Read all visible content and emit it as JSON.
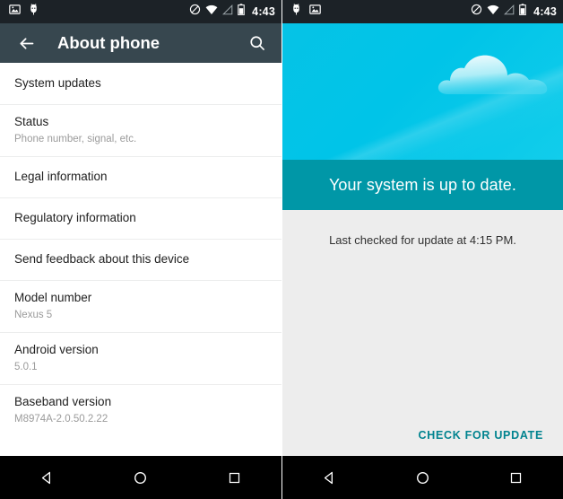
{
  "left_phone": {
    "status_bar": {
      "icons": [
        "screenshot-icon",
        "usb-debug-icon"
      ],
      "right_icons": [
        "do-not-disturb-icon",
        "wifi-icon",
        "cell-signal-icon",
        "battery-icon"
      ],
      "time": "4:43"
    },
    "toolbar": {
      "back_icon": "arrow-back-icon",
      "title": "About phone",
      "search_icon": "search-icon"
    },
    "list": [
      {
        "title": "System updates",
        "subtitle": ""
      },
      {
        "title": "Status",
        "subtitle": "Phone number, signal, etc."
      },
      {
        "title": "Legal information",
        "subtitle": ""
      },
      {
        "title": "Regulatory information",
        "subtitle": ""
      },
      {
        "title": "Send feedback about this device",
        "subtitle": ""
      },
      {
        "title": "Model number",
        "subtitle": "Nexus 5"
      },
      {
        "title": "Android version",
        "subtitle": "5.0.1"
      },
      {
        "title": "Baseband version",
        "subtitle": "M8974A-2.0.50.2.22"
      }
    ],
    "nav_bar": {
      "back": "back-triangle-icon",
      "home": "home-circle-icon",
      "recents": "recents-square-icon"
    }
  },
  "right_phone": {
    "status_bar": {
      "icons": [
        "usb-debug-icon",
        "screenshot-icon"
      ],
      "right_icons": [
        "do-not-disturb-icon",
        "wifi-icon",
        "cell-signal-icon",
        "battery-icon"
      ],
      "time": "4:43"
    },
    "hero": {
      "illustration": "cloud-icon",
      "banner_text": "Your system is up to date."
    },
    "last_checked": "Last checked for update at 4:15 PM.",
    "check_button": "CHECK FOR UPDATE",
    "nav_bar": {
      "back": "back-triangle-icon",
      "home": "home-circle-icon",
      "recents": "recents-square-icon"
    }
  },
  "colors": {
    "status_bar": "#1C2227",
    "toolbar": "#37474F",
    "hero_cyan": "#00C4E8",
    "hero_band_teal": "#0097A7",
    "body_gray": "#EDEDED",
    "accent_teal": "#00838F",
    "primary_text": "#212121",
    "secondary_text": "#9B9B9B",
    "nav_bar": "#000000"
  }
}
